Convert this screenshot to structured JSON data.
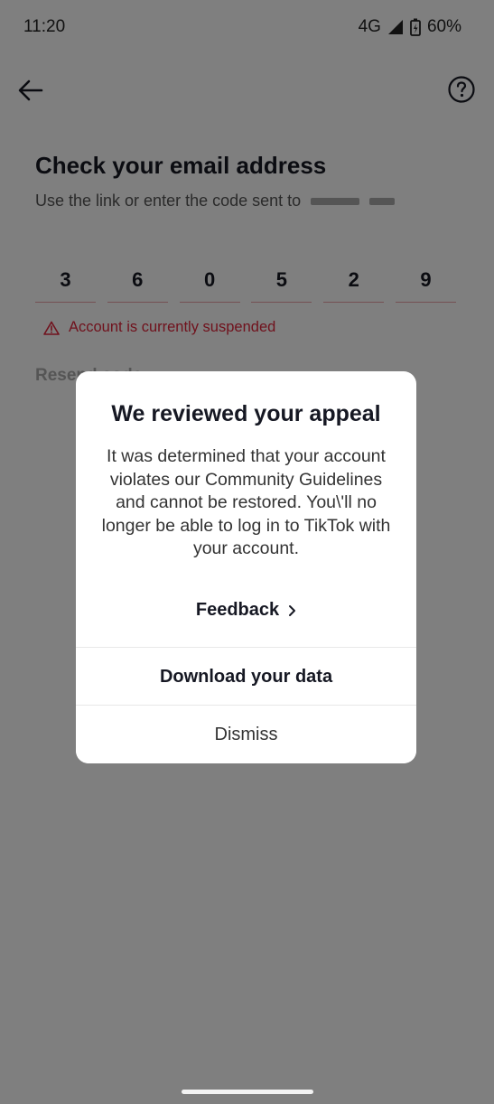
{
  "status_bar": {
    "time": "11:20",
    "network": "4G",
    "battery": "60%"
  },
  "header": {
    "back_icon": "arrow-left-icon",
    "help_icon": "question-circle-icon"
  },
  "page": {
    "title": "Check your email address",
    "subtitle": "Use the link or enter the code sent to",
    "code_digits": [
      "3",
      "6",
      "0",
      "5",
      "2",
      "9"
    ],
    "error_message": "Account is currently suspended",
    "resend_label": "Resend code",
    "error_color": "#e0243a"
  },
  "modal": {
    "title": "We reviewed your appeal",
    "body": "It was determined that your account violates our Community Guidelines and cannot be restored. You\\'ll no longer be able to log in to TikTok with your account.",
    "feedback_label": "Feedback",
    "download_label": "Download your data",
    "dismiss_label": "Dismiss"
  }
}
